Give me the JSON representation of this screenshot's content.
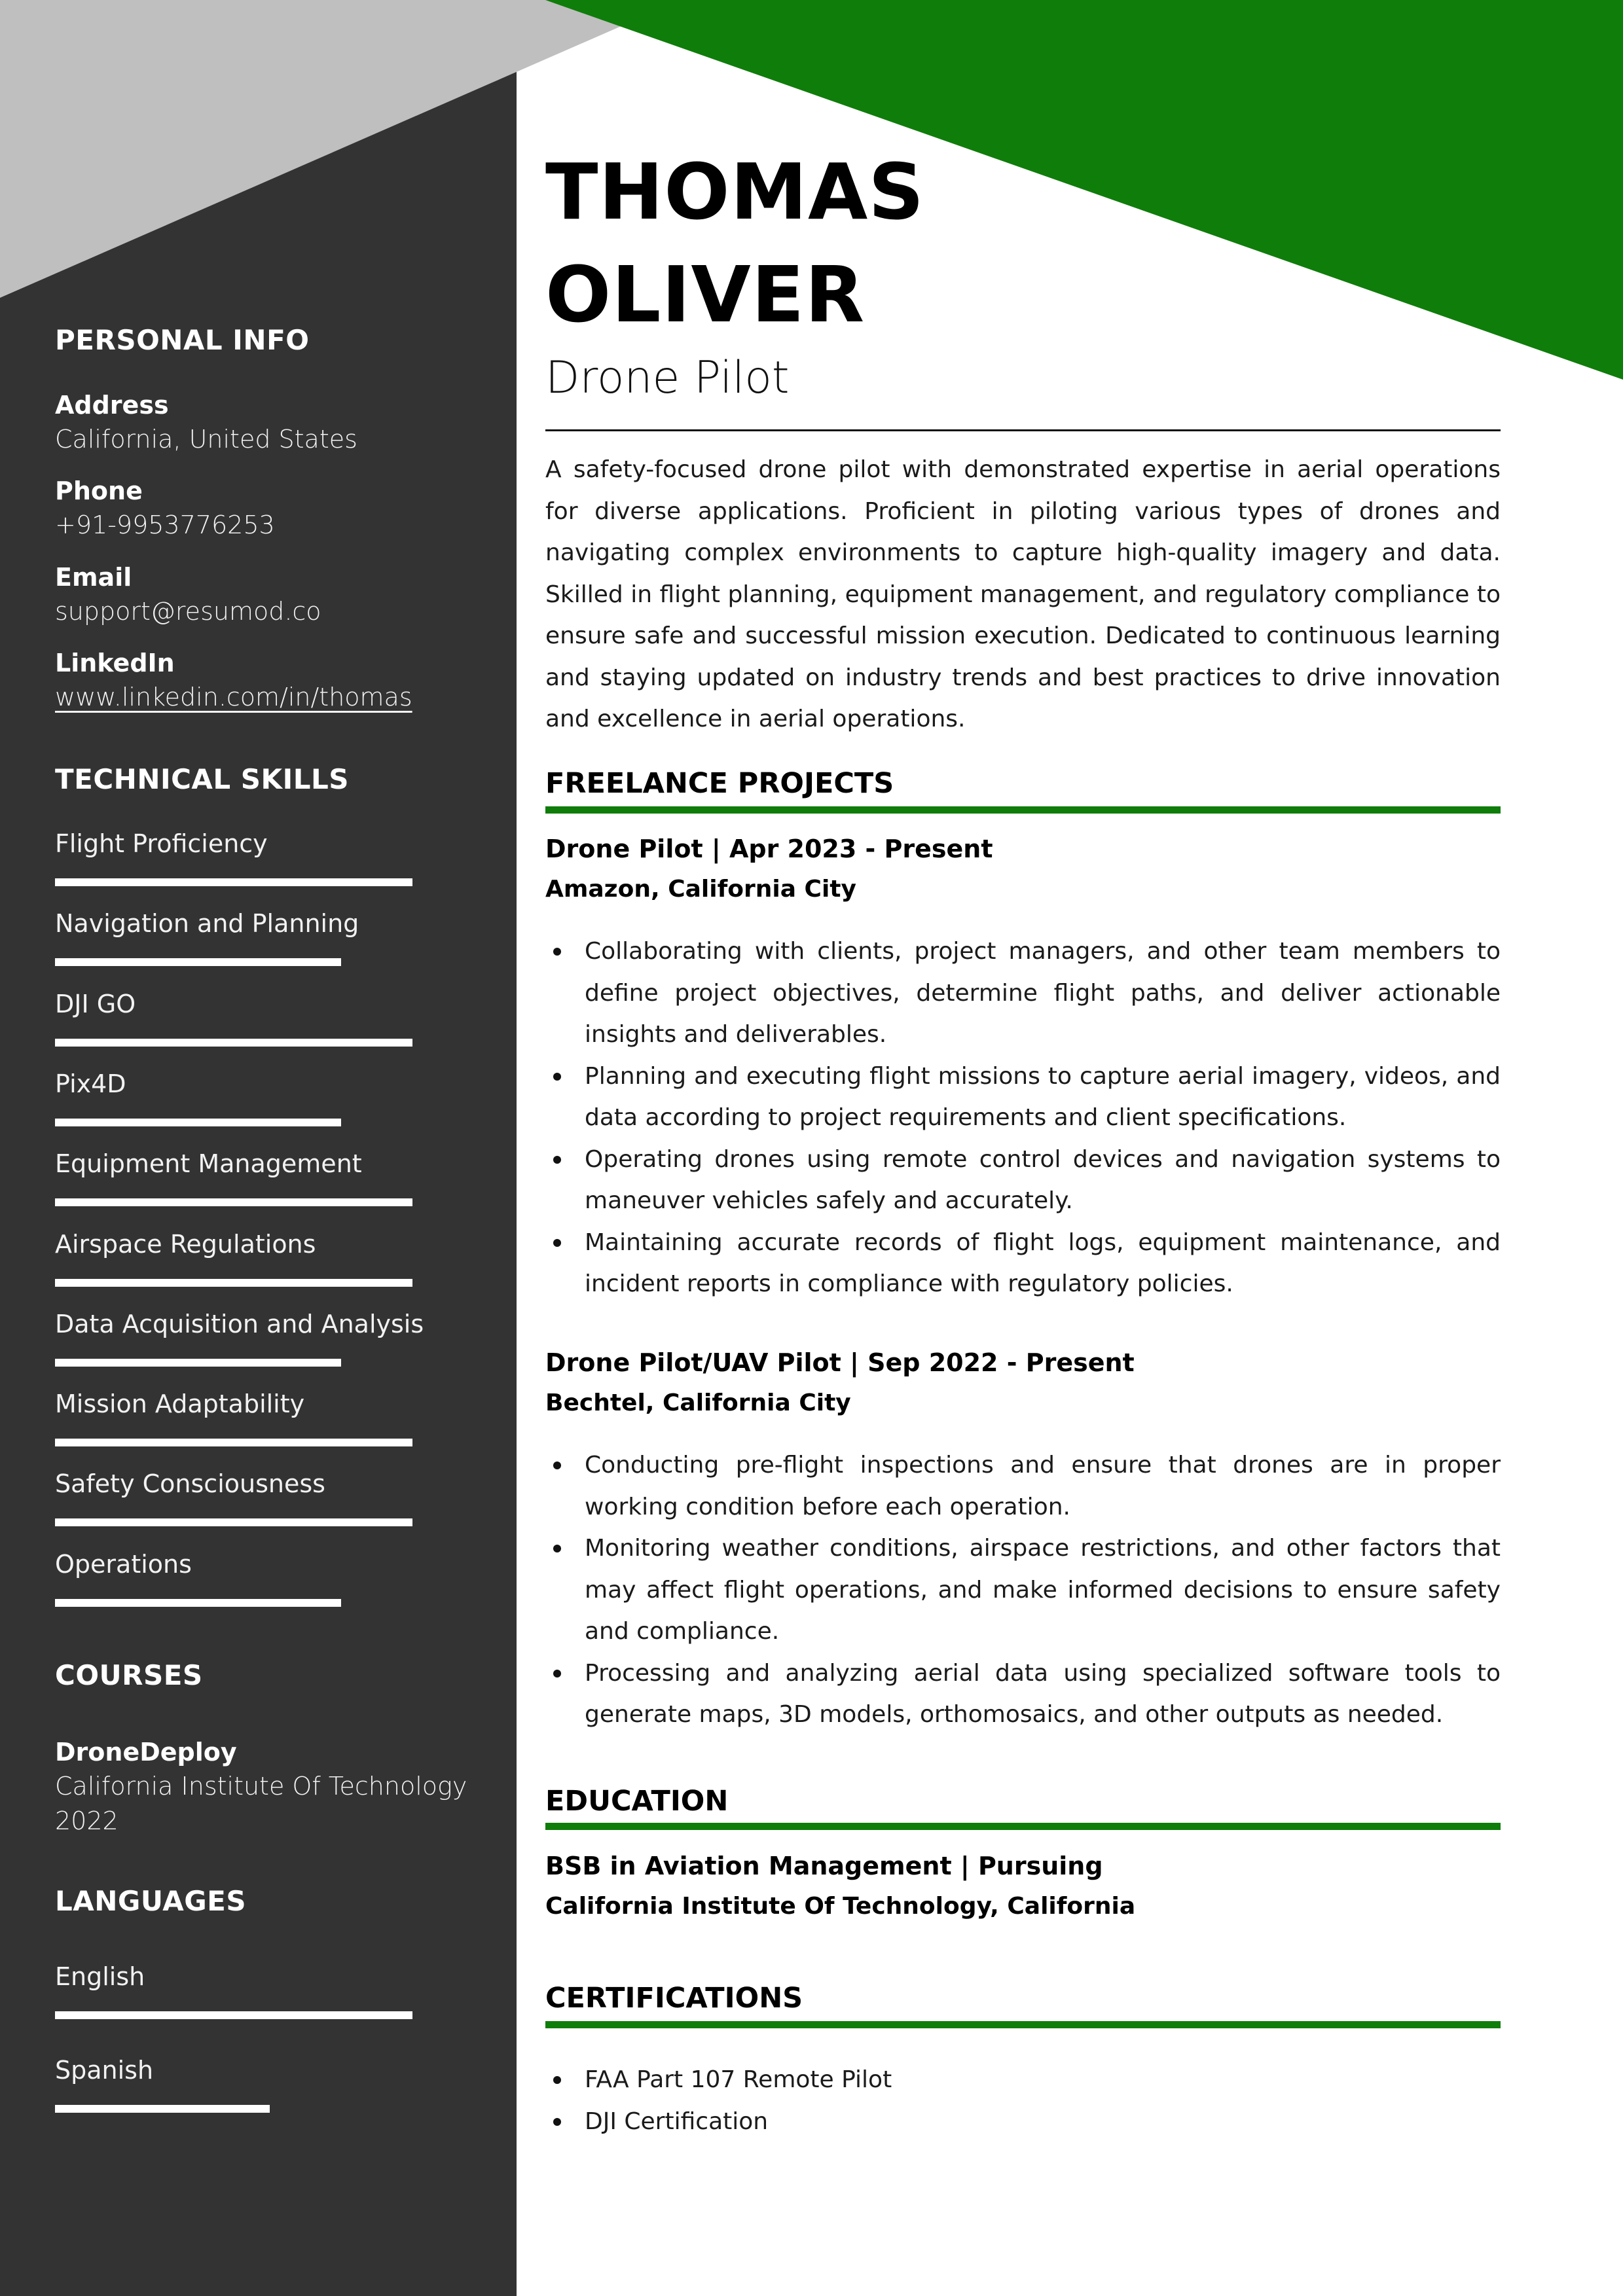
{
  "theme": {
    "accent": "#0f7d0a",
    "sidebar_bg": "#333333",
    "corner_grey": "#bfbfbf"
  },
  "header": {
    "first_name": "THOMAS",
    "last_name": "OLIVER",
    "job_title": "Drone Pilot"
  },
  "summary": "A safety-focused drone pilot with demonstrated expertise in aerial operations for diverse applications. Proficient in piloting various types of drones and navigating complex environments to capture high-quality imagery and data. Skilled in flight planning, equipment management, and regulatory compliance to ensure safe and successful mission execution. Dedicated to continuous learning and staying updated on industry trends and best practices to drive innovation and excellence in aerial operations.",
  "sidebar": {
    "personal_info": {
      "heading": "PERSONAL INFO",
      "address_label": "Address",
      "address": "California, United States",
      "phone_label": "Phone",
      "phone": "+91-9953776253",
      "email_label": "Email",
      "email": "support@resumod.co",
      "linkedin_label": "LinkedIn",
      "linkedin": "www.linkedin.com/in/thomas"
    },
    "skills": {
      "heading": "TECHNICAL SKILLS",
      "level_max": 5,
      "items": [
        {
          "name": "Flight Proficiency",
          "level": 5
        },
        {
          "name": "Navigation and Planning",
          "level": 4
        },
        {
          "name": "DJI GO",
          "level": 5
        },
        {
          "name": "Pix4D",
          "level": 4
        },
        {
          "name": "Equipment Management",
          "level": 5
        },
        {
          "name": "Airspace Regulations",
          "level": 5
        },
        {
          "name": "Data Acquisition and Analysis",
          "level": 4
        },
        {
          "name": "Mission Adaptability",
          "level": 5
        },
        {
          "name": "Safety Consciousness",
          "level": 5
        },
        {
          "name": "Operations",
          "level": 4
        }
      ]
    },
    "courses": {
      "heading": "COURSES",
      "items": [
        {
          "name": "DroneDeploy",
          "institution": "California Institute Of Technology",
          "year": "2022"
        }
      ]
    },
    "languages": {
      "heading": "LANGUAGES",
      "level_max": 5,
      "items": [
        {
          "name": "English",
          "level": 5
        },
        {
          "name": "Spanish",
          "level": 3
        }
      ]
    }
  },
  "projects": {
    "heading": "FREELANCE PROJECTS",
    "items": [
      {
        "title": "Drone Pilot | Apr 2023 - Present",
        "company": "Amazon, California City",
        "bullets": [
          "Collaborating with clients, project managers, and other team members to define project objectives, determine flight paths, and deliver actionable insights and deliverables.",
          "Planning and executing flight missions to capture aerial imagery, videos, and data according to project requirements and client specifications.",
          "Operating drones using remote control devices and navigation systems to maneuver vehicles safely and accurately.",
          "Maintaining accurate records of flight logs, equipment maintenance, and incident reports in compliance with regulatory policies."
        ]
      },
      {
        "title": "Drone Pilot/UAV Pilot | Sep 2022 - Present",
        "company": "Bechtel, California City",
        "bullets": [
          "Conducting pre-flight inspections and ensure that drones are in proper working condition before each operation.",
          "Monitoring weather conditions, airspace restrictions, and other factors that may affect flight operations, and make informed decisions to ensure safety and compliance.",
          "Processing and analyzing aerial data using specialized software tools to generate maps, 3D models, orthomosaics, and other outputs as needed."
        ]
      }
    ]
  },
  "education": {
    "heading": "EDUCATION",
    "degree": "BSB in Aviation Management | Pursuing",
    "school": "California Institute Of Technology, California"
  },
  "certifications": {
    "heading": "CERTIFICATIONS",
    "items": [
      "FAA Part 107 Remote Pilot",
      "DJI Certification"
    ]
  }
}
